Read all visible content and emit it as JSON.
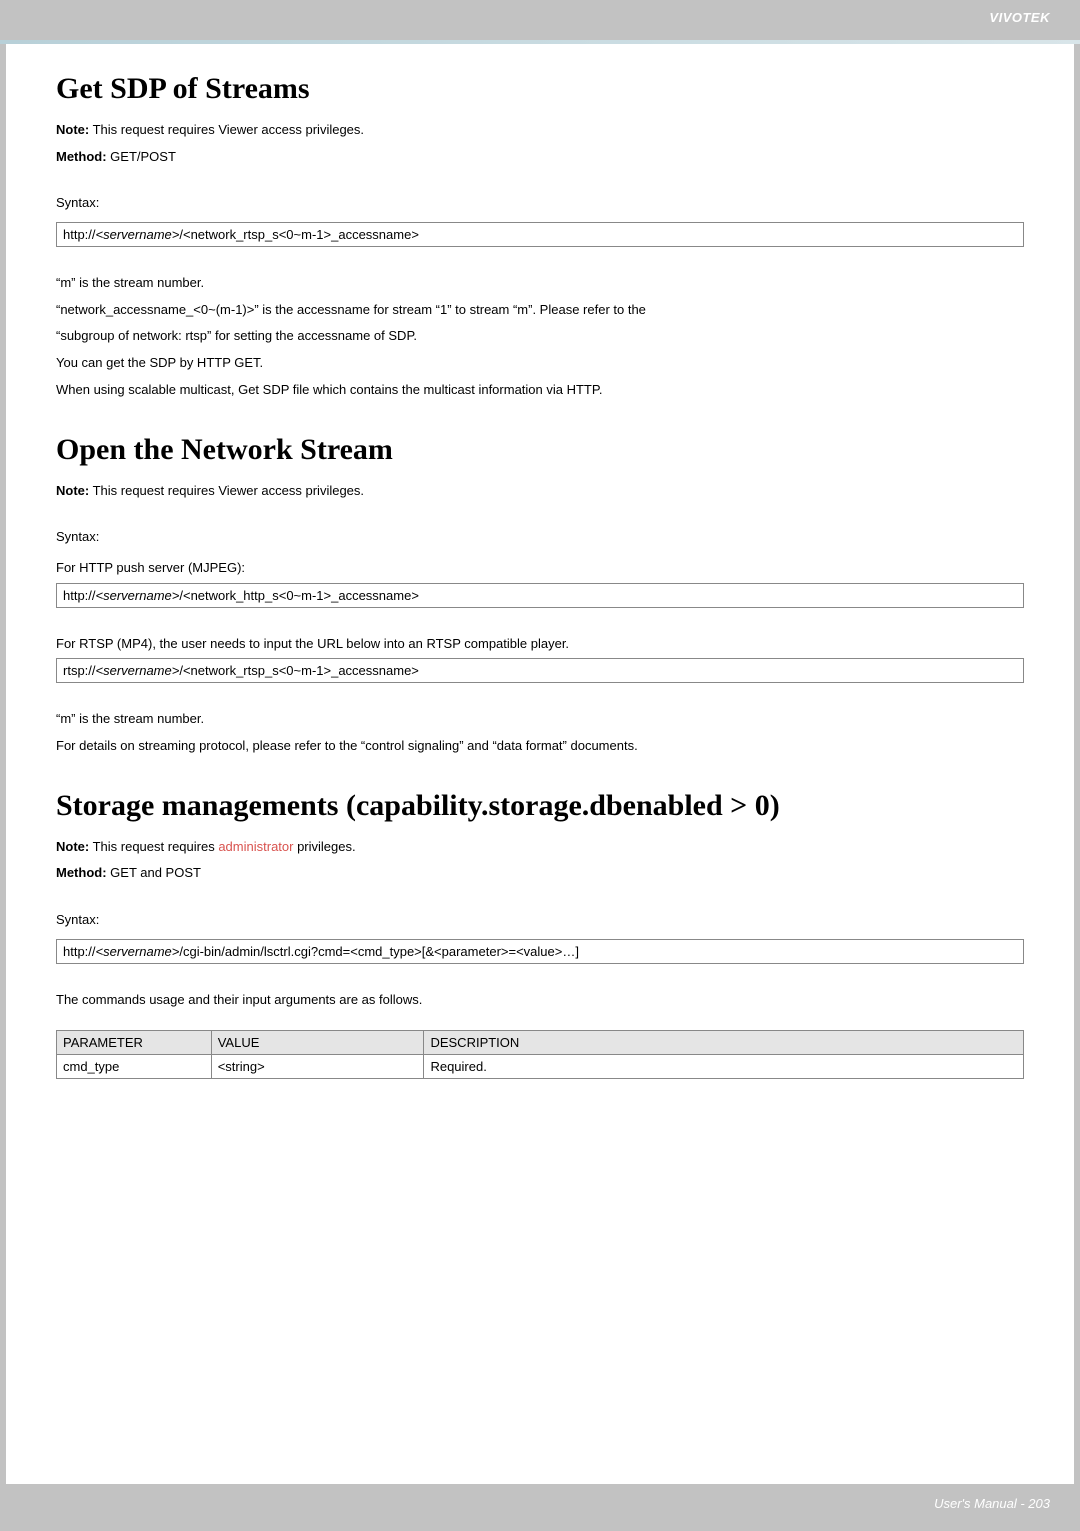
{
  "header": {
    "brand": "VIVOTEK"
  },
  "section1": {
    "title": "Get SDP of Streams",
    "note_label": "Note:",
    "note_text": " This request requires Viewer access privileges.",
    "method_label": "Method:",
    "method_text": " GET/POST",
    "syntax_label": "Syntax:",
    "code_prefix": "http://",
    "code_server": "<servername>",
    "code_suffix": "/<network_rtsp_s<0~m-1>_accessname>",
    "desc1": "“m” is the stream number.",
    "desc2": "“network_accessname_<0~(m-1)>” is the accessname for stream “1” to stream “m”. Please refer to the",
    "desc3": "“subgroup of network: rtsp” for setting the accessname of SDP.",
    "desc4": "You can get the SDP by HTTP GET.",
    "desc5": "When using scalable multicast, Get SDP file which contains the multicast information via HTTP."
  },
  "section2": {
    "title": "Open the Network Stream",
    "note_label": "Note:",
    "note_text": " This request requires Viewer access privileges.",
    "syntax_label": "Syntax:",
    "for_http": "For HTTP push server (MJPEG):",
    "code1_prefix": "http://",
    "code1_server": "<servername>",
    "code1_suffix": "/<network_http_s<0~m-1>_accessname>",
    "for_rtsp": "For RTSP (MP4), the user needs to input the URL below into an RTSP compatible player.",
    "code2_prefix": "rtsp://",
    "code2_server": "<servername>",
    "code2_suffix": "/<network_rtsp_s<0~m-1>_accessname>",
    "desc1": "“m” is the stream number.",
    "desc2": "For details on streaming protocol, please refer to the “control signaling” and “data format” documents."
  },
  "section3": {
    "title": "Storage managements (capability.storage.dbenabled > 0)",
    "note_label": "Note:",
    "note_pre": " This request requires ",
    "note_red": "administrator",
    "note_post": " privileges.",
    "method_label": "Method:",
    "method_text": " GET and POST",
    "syntax_label": "Syntax:",
    "code_prefix": "http://",
    "code_server": "<servername>",
    "code_suffix": "/cgi-bin/admin/lsctrl.cgi?cmd=<cmd_type>[&<parameter>=<value>…]",
    "desc1": "The commands usage and their input arguments are as follows.",
    "table": {
      "h1": "PARAMETER",
      "h2": "VALUE",
      "h3": "DESCRIPTION",
      "r1c1": "cmd_type",
      "r1c2": "<string>",
      "r1c3": "Required."
    }
  },
  "footer": {
    "text": "User's Manual - 203"
  }
}
